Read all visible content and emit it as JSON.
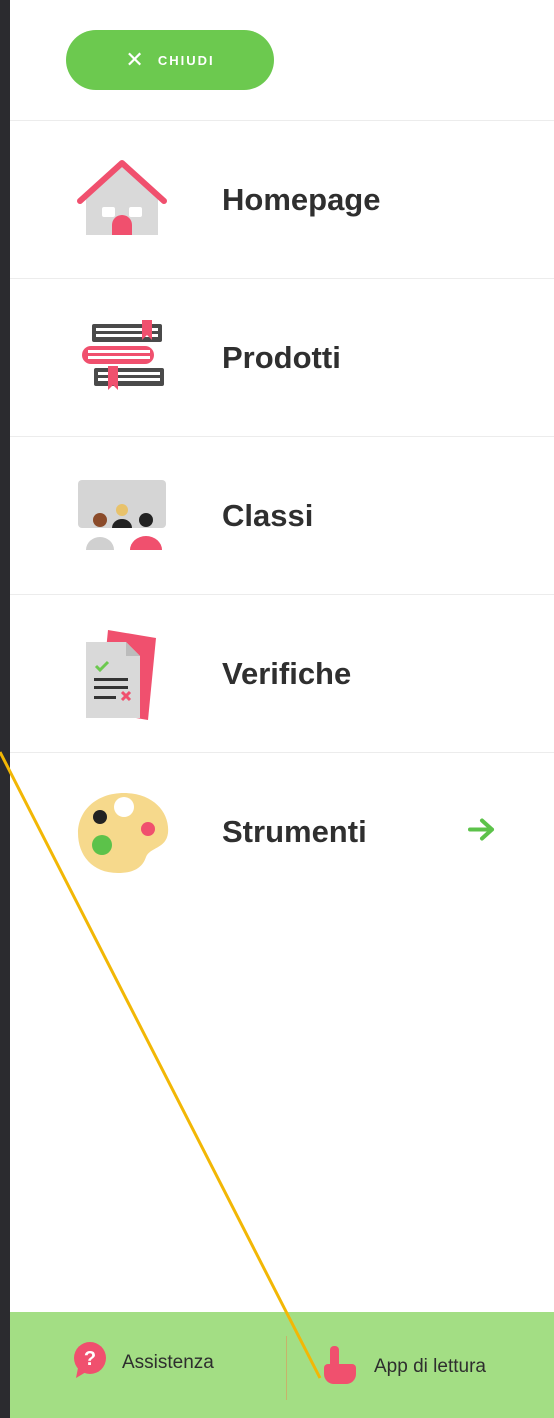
{
  "close_button": {
    "label": "CHIUDI",
    "icon": "close-icon"
  },
  "menu": {
    "items": [
      {
        "label": "Homepage",
        "icon": "house-icon"
      },
      {
        "label": "Prodotti",
        "icon": "books-icon"
      },
      {
        "label": "Classi",
        "icon": "classroom-icon"
      },
      {
        "label": "Verifiche",
        "icon": "test-document-icon"
      },
      {
        "label": "Strumenti",
        "icon": "palette-icon",
        "trailing_icon": "arrow-right-icon"
      }
    ]
  },
  "footer": {
    "assist_label": "Assistenza",
    "assist_icon": "question-icon",
    "app_label": "App di lettura",
    "app_icon": "pointer-hand-icon"
  },
  "colors": {
    "accent_green": "#6cc94f",
    "footer_green": "#a3de84",
    "accent_pink": "#f0506e",
    "annotation_line": "#f2b705"
  }
}
